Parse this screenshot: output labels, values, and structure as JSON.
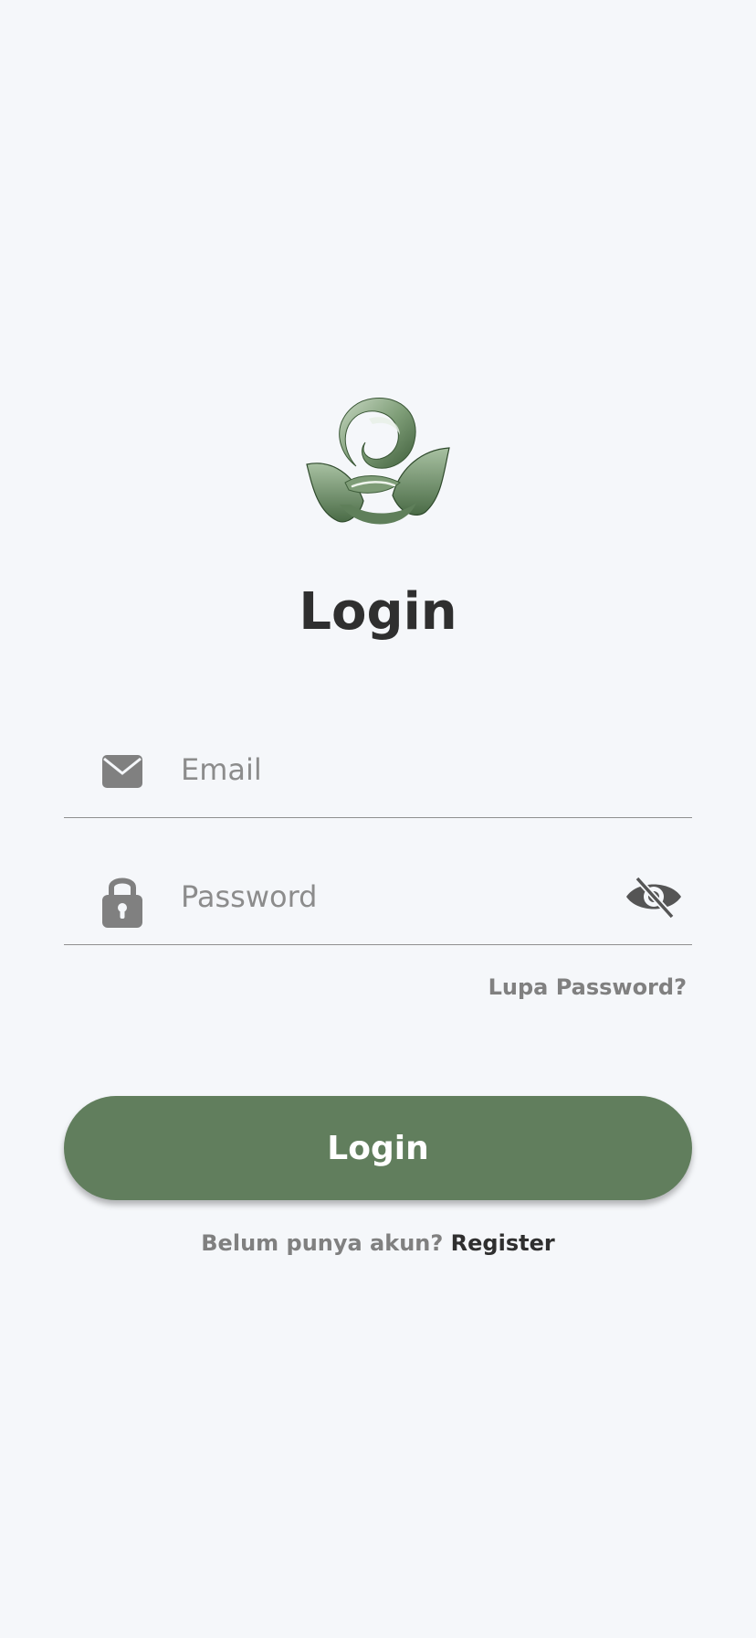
{
  "colors": {
    "background": "#f5f7fa",
    "brand_green": "#617e5d",
    "title_text": "#2f2f2f",
    "muted_text": "#808080",
    "icon_gray": "#808080",
    "divider": "#8f8f8f"
  },
  "logo": {
    "icon": "leaf-swirl-logo"
  },
  "screen": {
    "title": "Login"
  },
  "form": {
    "email": {
      "icon": "envelope-icon",
      "value": "",
      "placeholder": "Email"
    },
    "password": {
      "icon": "lock-icon",
      "value": "",
      "placeholder": "Password",
      "visibility_icon": "eye-off-icon"
    },
    "forgot_label": "Lupa Password?",
    "submit_label": "Login"
  },
  "footer": {
    "prompt": "Belum punya akun?",
    "register_label": "Register"
  }
}
